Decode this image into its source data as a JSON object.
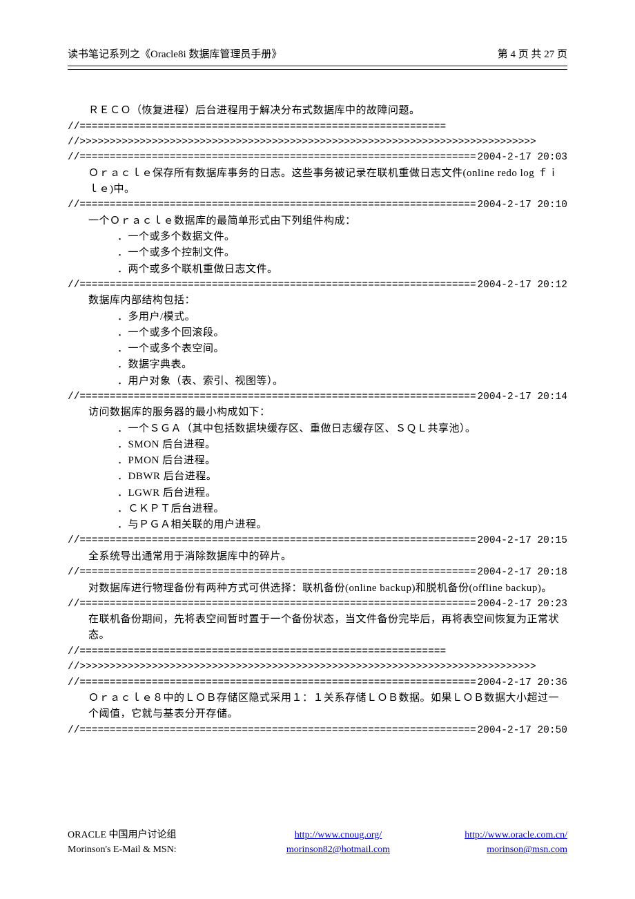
{
  "header": {
    "left": "读书笔记系列之《Oracle8i 数据库管理员手册》",
    "right": "第 4 页   共 27 页"
  },
  "separators": {
    "eq_plain_1": "//=============================================================",
    "gt_plain_1": "//>>>>>>>>>>>>>>>>>>>>>>>>>>>>>>>>>>>>>>>>>>>>>>>>>>>>>>>>>>>>>>>>>>>>>>>>>>>>",
    "eq_fill": "//===============================================================================================",
    "eq_plain_2": "//=============================================================",
    "gt_plain_2": "//>>>>>>>>>>>>>>>>>>>>>>>>>>>>>>>>>>>>>>>>>>>>>>>>>>>>>>>>>>>>>>>>>>>>>>>>>>>>"
  },
  "timestamps": {
    "t1": "2004-2-17 20:03",
    "t2": "2004-2-17 20:10",
    "t3": "2004-2-17 20:12",
    "t4": "2004-2-17 20:14",
    "t5": "2004-2-17 20:15",
    "t6": "2004-2-17 20:18",
    "t7": "2004-2-17 20:23",
    "t8": "2004-2-17 20:36",
    "t9": "2004-2-17 20:50"
  },
  "body": {
    "p0": "ＲＥＣＯ（恢复进程）后台进程用于解决分布式数据库中的故障问题。",
    "p1": "Ｏｒａｃｌｅ保存所有数据库事务的日志。这些事务被记录在联机重做日志文件(online redo log ｆｉｌｅ)中。",
    "p2": "一个Ｏｒａｃｌｅ数据库的最简单形式由下列组件构成：",
    "p2_items": [
      "．一个或多个数据文件。",
      "．一个或多个控制文件。",
      "．两个或多个联机重做日志文件。"
    ],
    "p3": "数据库内部结构包括：",
    "p3_items": [
      "．多用户/模式。",
      "．一个或多个回滚段。",
      "．一个或多个表空间。",
      "．数据字典表。",
      "．用户对象（表、索引、视图等）。"
    ],
    "p4": "访问数据库的服务器的最小构成如下：",
    "p4_items": [
      "．一个ＳＧＡ（其中包括数据块缓存区、重做日志缓存区、ＳＱＬ共享池）。",
      "．SMON 后台进程。",
      "．PMON 后台进程。",
      "．DBWR 后台进程。",
      "．LGWR 后台进程。",
      "．ＣＫＰＴ后台进程。",
      "．与ＰＧＡ相关联的用户进程。"
    ],
    "p5": "全系统导出通常用于消除数据库中的碎片。",
    "p6": "对数据库进行物理备份有两种方式可供选择：联机备份(online backup)和脱机备份(offline backup)。",
    "p7": "在联机备份期间，先将表空间暂时置于一个备份状态，当文件备份完毕后，再将表空间恢复为正常状态。",
    "p8": "Ｏｒａｃｌｅ８中的ＬＯＢ存储区隐式采用１：１关系存储ＬＯＢ数据。如果ＬＯＢ数据大小超过一个阈值，它就与基表分开存储。"
  },
  "footer": {
    "row1_left": "ORACLE 中国用户讨论组",
    "row1_mid": "http://www.cnoug.org/",
    "row1_right": "http://www.oracle.com.cn/",
    "row2_left": "Morinson's E-Mail & MSN:",
    "row2_mid": "morinson82@hotmail.com",
    "row2_right": "morinson@msn.com"
  }
}
